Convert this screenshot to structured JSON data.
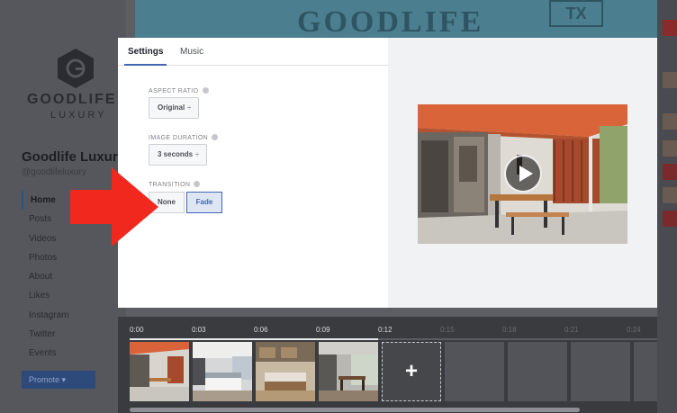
{
  "background": {
    "banner_text": "GOODLIFE",
    "banner_badge": "TX",
    "brand_name": "GOODLIFE",
    "brand_sub": "LUXURY",
    "page_name": "Goodlife Luxury",
    "page_handle": "@goodlifeluxury",
    "nav": [
      "Home",
      "Posts",
      "Videos",
      "Photos",
      "About",
      "Likes",
      "Instagram",
      "Twitter",
      "Events"
    ],
    "promote_label": "Promote"
  },
  "modal": {
    "tabs": [
      {
        "label": "Settings",
        "active": true
      },
      {
        "label": "Music",
        "active": false
      }
    ],
    "aspect_ratio": {
      "label": "ASPECT RATIO",
      "value": "Original"
    },
    "image_duration": {
      "label": "IMAGE DURATION",
      "value": "3 seconds"
    },
    "transition": {
      "label": "TRANSITION",
      "options": [
        "None",
        "Fade"
      ],
      "selected": "Fade"
    },
    "caret": "÷"
  },
  "timeline": {
    "ticks": [
      "0:00",
      "0:03",
      "0:06",
      "0:09",
      "0:12",
      "0:15",
      "0:18",
      "0:21",
      "0:24"
    ],
    "active_ticks": 5,
    "clips": [
      "Patio",
      "Bedroom",
      "Kitchen",
      "Dining room"
    ],
    "add_label": "+"
  },
  "colors": {
    "accent": "#4267b2",
    "arrow": "#f0281e"
  }
}
